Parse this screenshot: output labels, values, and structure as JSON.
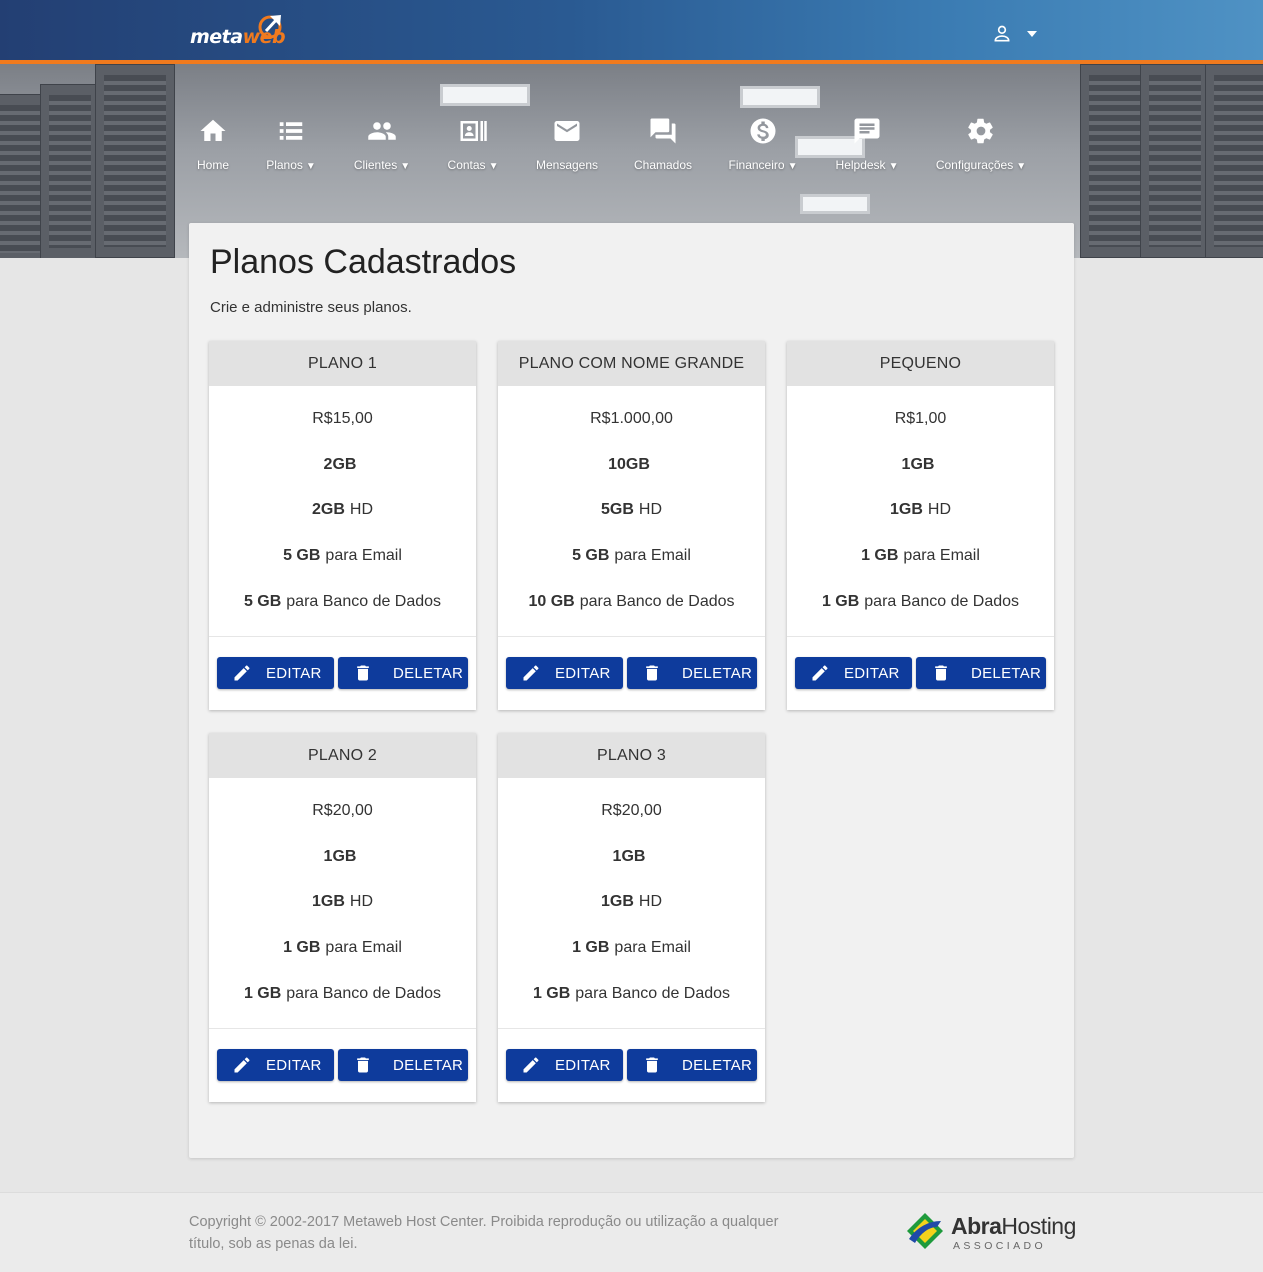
{
  "brand": {
    "logo_part1": "meta",
    "logo_part2": "web"
  },
  "header": {
    "user_icon": "person-icon",
    "dropdown_icon": "caret-down-icon"
  },
  "nav": [
    {
      "label": "Home",
      "icon": "home-icon",
      "dropdown": false
    },
    {
      "label": "Planos",
      "icon": "list-icon",
      "dropdown": true
    },
    {
      "label": "Clientes",
      "icon": "people-icon",
      "dropdown": true
    },
    {
      "label": "Contas",
      "icon": "contact-card-icon",
      "dropdown": true
    },
    {
      "label": "Mensagens",
      "icon": "mail-icon",
      "dropdown": false
    },
    {
      "label": "Chamados",
      "icon": "forum-icon",
      "dropdown": false
    },
    {
      "label": "Financeiro",
      "icon": "dollar-icon",
      "dropdown": true
    },
    {
      "label": "Helpdesk",
      "icon": "chat-icon",
      "dropdown": true
    },
    {
      "label": "Configurações",
      "icon": "gear-icon",
      "dropdown": true
    }
  ],
  "page": {
    "title": "Planos Cadastrados",
    "subtitle": "Crie e administre seus planos."
  },
  "plans": [
    {
      "name": "PLANO 1",
      "price": "R$15,00",
      "ram": "2GB",
      "hd_value": "2GB",
      "hd_label": "HD",
      "email_value": "5 GB",
      "email_label": "para Email",
      "db_value": "5 GB",
      "db_label": "para Banco de Dados"
    },
    {
      "name": "PLANO COM NOME GRANDE",
      "price": "R$1.000,00",
      "ram": "10GB",
      "hd_value": "5GB",
      "hd_label": "HD",
      "email_value": "5 GB",
      "email_label": "para Email",
      "db_value": "10 GB",
      "db_label": "para Banco de Dados"
    },
    {
      "name": "PEQUENO",
      "price": "R$1,00",
      "ram": "1GB",
      "hd_value": "1GB",
      "hd_label": "HD",
      "email_value": "1 GB",
      "email_label": "para Email",
      "db_value": "1 GB",
      "db_label": "para Banco de Dados"
    },
    {
      "name": "PLANO 2",
      "price": "R$20,00",
      "ram": "1GB",
      "hd_value": "1GB",
      "hd_label": "HD",
      "email_value": "1 GB",
      "email_label": "para Email",
      "db_value": "1 GB",
      "db_label": "para Banco de Dados"
    },
    {
      "name": "PLANO 3",
      "price": "R$20,00",
      "ram": "1GB",
      "hd_value": "1GB",
      "hd_label": "HD",
      "email_value": "1 GB",
      "email_label": "para Email",
      "db_value": "1 GB",
      "db_label": "para Banco de Dados"
    }
  ],
  "actions": {
    "edit_label": "EDITAR",
    "edit_icon": "pencil-icon",
    "delete_label": "DELETAR",
    "delete_icon": "trash-icon"
  },
  "footer": {
    "copyright": "Copyright © 2002-2017 Metaweb Host Center. Proibida reprodução ou utilização a qualquer título, sob as penas da lei.",
    "partner_part1": "Abra",
    "partner_part2": "Hosting",
    "partner_sub": "ASSOCIADO"
  },
  "colors": {
    "header_blue": "#2a5a92",
    "accent_orange": "#f07a1e",
    "button_blue": "#0e3b9c",
    "card_header": "#e2e2e2"
  }
}
